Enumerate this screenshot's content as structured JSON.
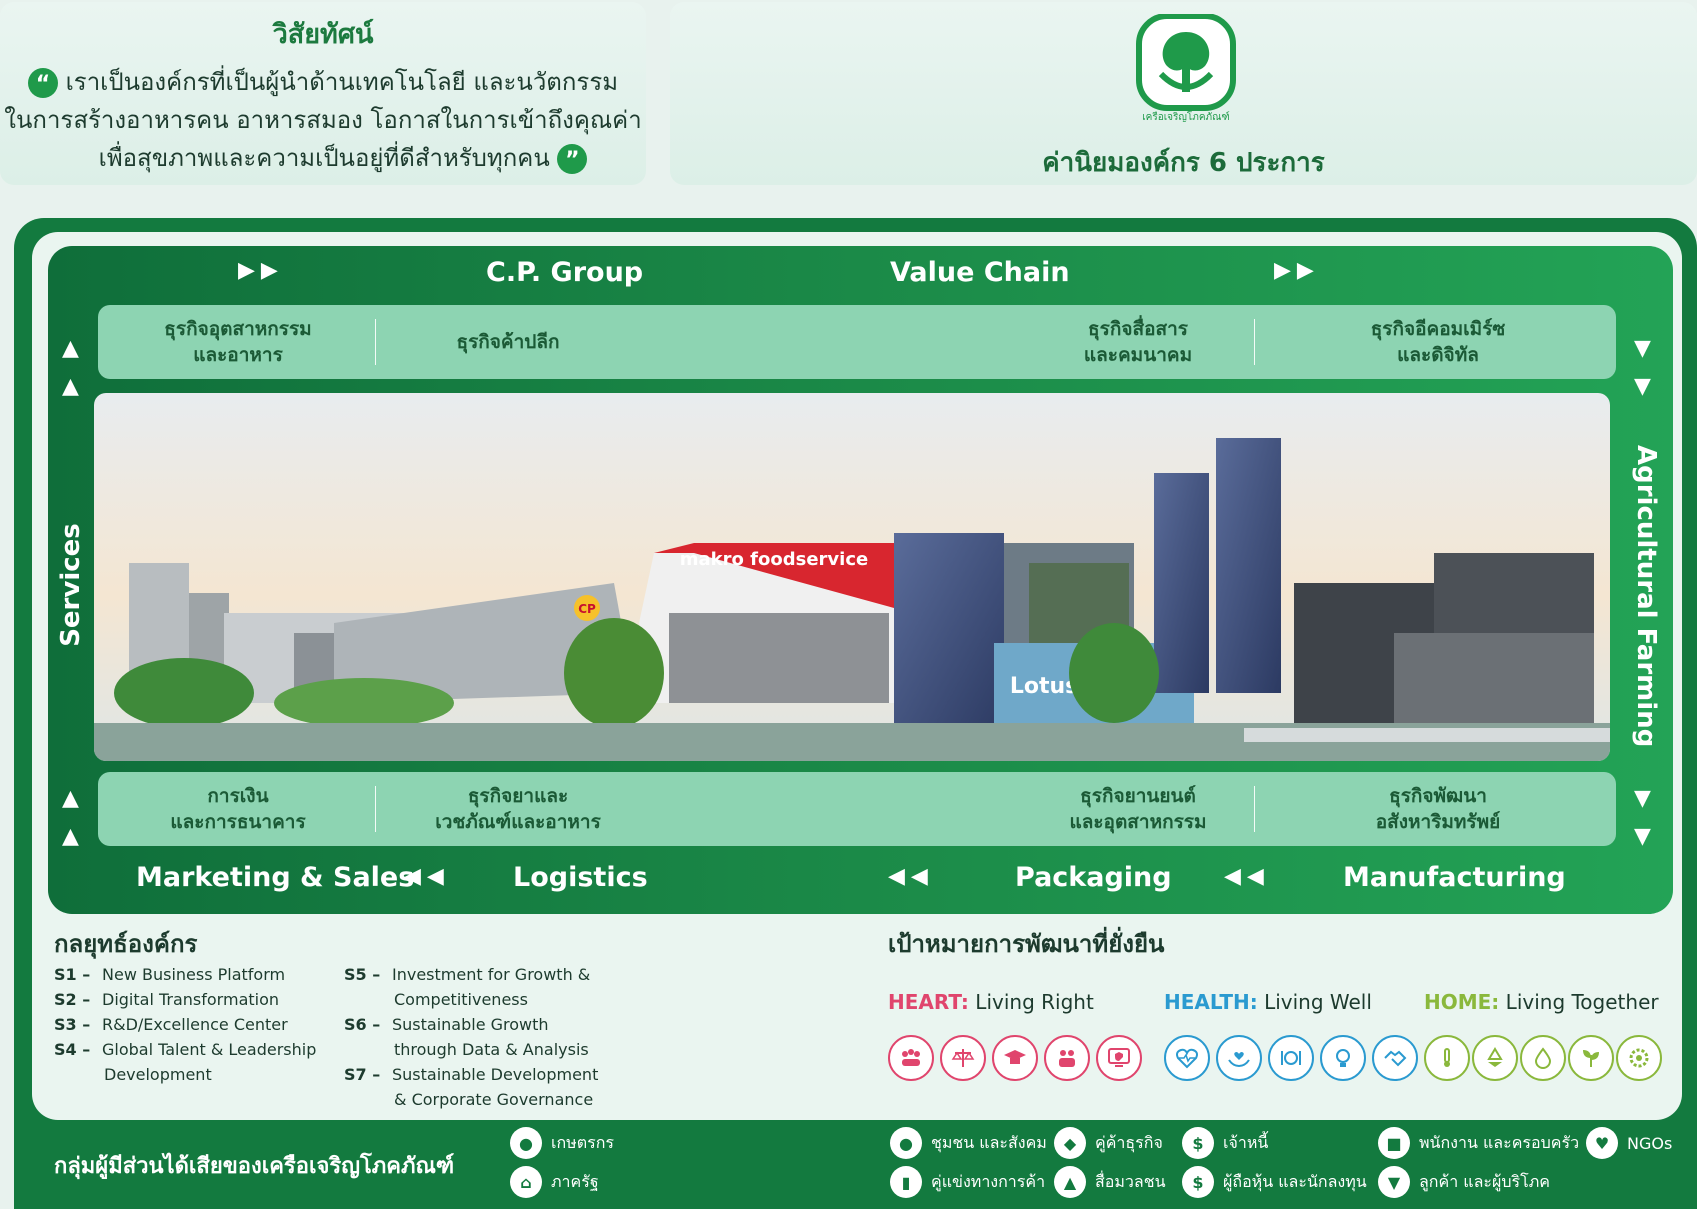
{
  "vision": {
    "title": "วิสัยทัศน์",
    "line1": "เราเป็นองค์กรที่เป็นผู้นำด้านเทคโนโลยี และนวัตกรรม",
    "line2": "ในการสร้างอาหารคน อาหารสมอง โอกาสในการเข้าถึงคุณค่า",
    "line3": "เพื่อสุขภาพและความเป็นอยู่ที่ดีสำหรับทุกคน"
  },
  "values": {
    "logo_text": "เครือเจริญโภคภัณฑ์",
    "title": "ค่านิยมองค์กร 6 ประการ"
  },
  "value_chain": {
    "top_left": "C.P. Group",
    "top_right": "Value Chain",
    "left_side": "Services",
    "right_side": "Agricultural Farming",
    "bottom": [
      "Marketing & Sales",
      "Logistics",
      "Packaging",
      "Manufacturing"
    ],
    "top_business": [
      {
        "line1": "ธุรกิจอุตสาหกรรม",
        "line2": "และอาหาร"
      },
      {
        "line1": "ธุรกิจค้าปลีก",
        "line2": ""
      },
      {
        "line1": "ธุรกิจสื่อสาร",
        "line2": "และคมนาคม"
      },
      {
        "line1": "ธุรกิจอีคอมเมิร์ซ",
        "line2": "และดิจิทัล"
      }
    ],
    "bottom_business": [
      {
        "line1": "การเงิน",
        "line2": "และการธนาคาร"
      },
      {
        "line1": "ธุรกิจยาและ",
        "line2": "เวชภัณฑ์และอาหาร"
      },
      {
        "line1": "ธุรกิจยานยนต์",
        "line2": "และอุตสาหกรรม"
      },
      {
        "line1": "ธุรกิจพัฒนา",
        "line2": "อสังหาริมทรัพย์"
      }
    ],
    "photo_signs": {
      "food": "makro foodservice",
      "store": "Lotus's",
      "brand": "CP"
    }
  },
  "strategy": {
    "title": "กลยุทธ์องค์กร",
    "items_left": [
      {
        "code": "S1 –",
        "text": "New Business Platform",
        "cont": ""
      },
      {
        "code": "S2 –",
        "text": "Digital Transformation",
        "cont": ""
      },
      {
        "code": "S3 –",
        "text": "R&D/Excellence Center",
        "cont": ""
      },
      {
        "code": "S4 –",
        "text": "Global Talent & Leadership",
        "cont": "Development"
      }
    ],
    "items_right": [
      {
        "code": "S5 –",
        "text": "Investment for Growth &",
        "cont": "Competitiveness"
      },
      {
        "code": "S6 –",
        "text": "Sustainable Growth",
        "cont": "through Data & Analysis"
      },
      {
        "code": "S7 –",
        "text": "Sustainable Development",
        "cont": "& Corporate Governance"
      }
    ]
  },
  "sustainability": {
    "title": "เป้าหมายการพัฒนาที่ยั่งยืน",
    "heart": {
      "key": "HEART:",
      "text": "Living Right",
      "color": "#e0456d"
    },
    "health": {
      "key": "HEALTH:",
      "text": "Living Well",
      "color": "#2a9ad0"
    },
    "home": {
      "key": "HOME:",
      "text": "Living Together",
      "color": "#8ab83c"
    }
  },
  "stakeholders": {
    "title": "กลุ่มผู้มีส่วนได้เสียของเครือเจริญโภคภัณฑ์",
    "items": [
      "เกษตรกร",
      "ภาครัฐ",
      "ชุมชน และสังคม",
      "คู่แข่งทางการค้า",
      "คู่ค้าธุรกิจ",
      "สื่อมวลชน",
      "เจ้าหนี้",
      "ผู้ถือหุ้น และนักลงทุน",
      "พนักงาน และครอบครัว",
      "ลูกค้า และผู้บริโภค",
      "NGOs"
    ]
  },
  "colors": {
    "primary_green": "#137a3f",
    "light_green": "#8dd4b2"
  }
}
